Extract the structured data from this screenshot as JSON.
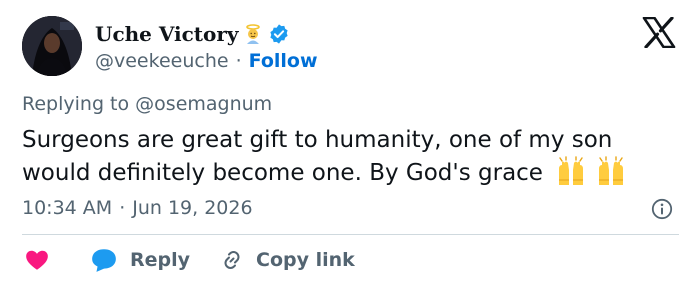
{
  "author": {
    "name": "Uche Victory",
    "name_emoji": "angel-emoji",
    "verified": true,
    "handle": "@veekeeuche",
    "separator": "·",
    "follow_label": "Follow"
  },
  "reply_context": {
    "prefix": "Replying to",
    "handle": "@osemagnum"
  },
  "tweet": {
    "text": "Surgeons are great gift to humanity, one of my son would definitely become one. By God's grace",
    "trailing_emoji": [
      "raising-hands-emoji",
      "raising-hands-emoji"
    ]
  },
  "meta": {
    "time": "10:34 AM",
    "separator": "·",
    "date": "Jun 19, 2026"
  },
  "actions": {
    "like_icon": "heart-icon",
    "reply_label": "Reply",
    "copy_label": "Copy link"
  },
  "colors": {
    "follow_blue": "#006fd6",
    "verified_blue": "#1d9bf0",
    "like_pink": "#f91880",
    "secondary_text": "#536471",
    "primary_text": "#0f1419"
  },
  "icons": {
    "logo": "x-logo-icon",
    "info": "info-icon",
    "link": "link-icon",
    "reply": "speech-bubble-icon",
    "verified": "verified-badge-icon"
  }
}
